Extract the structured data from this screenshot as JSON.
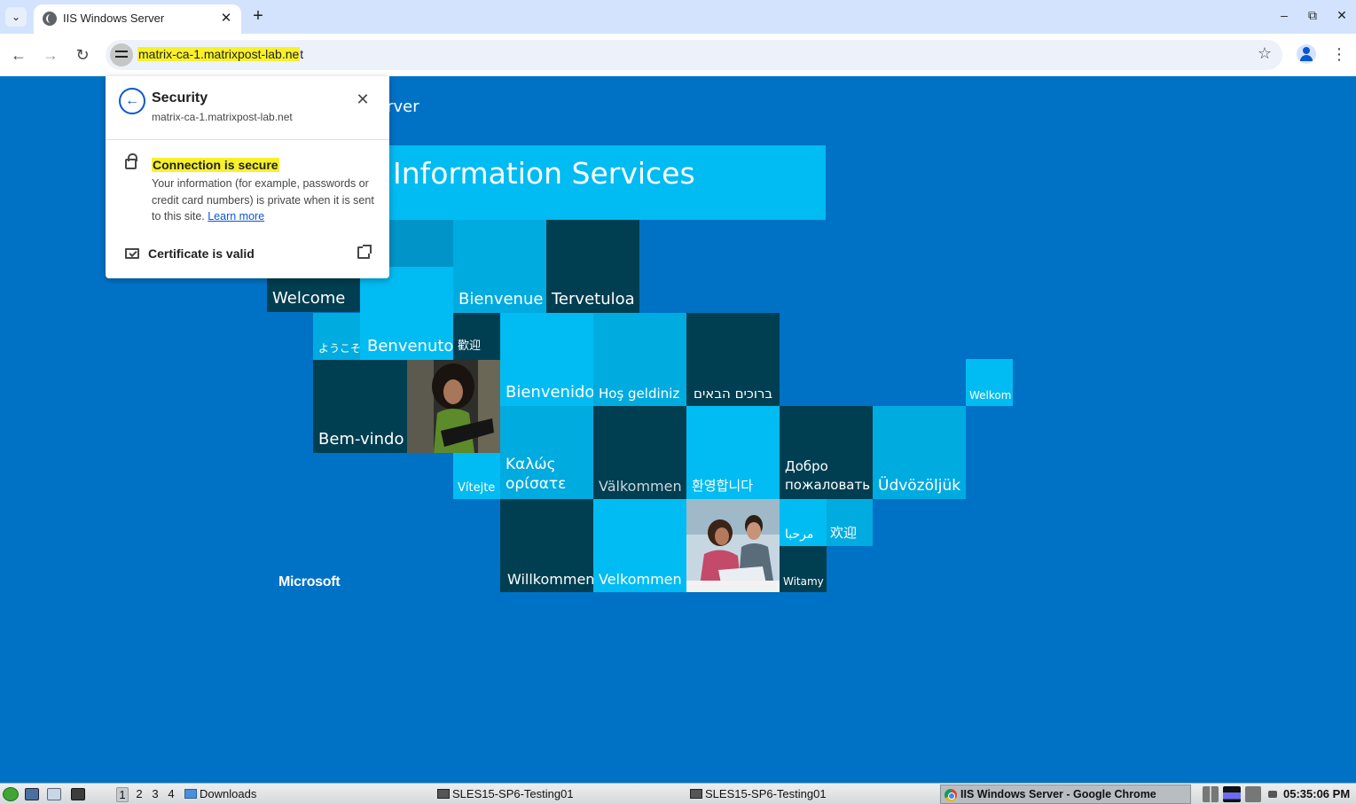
{
  "tab": {
    "title": "IIS Windows Server",
    "close": "✕"
  },
  "toolbar": {
    "back": "←",
    "forward": "→",
    "reload": "↻",
    "url_highlight": "matrix-ca-1.matrixpost-lab.ne",
    "url_rest": "t",
    "star": "☆",
    "menu": "⋮",
    "new_tab": "+",
    "tab_list": "⌄"
  },
  "window_controls": {
    "minimize": "–",
    "restore": "⧉",
    "close": "✕"
  },
  "popup": {
    "back": "←",
    "title": "Security",
    "host": "matrix-ca-1.matrixpost-lab.net",
    "close": "✕",
    "connection_title": "Connection is secure",
    "connection_desc": "Your information (for example, passwords or credit card numbers) is private when it is sent to this site.",
    "learn_more": "Learn more",
    "certificate": "Certificate is valid"
  },
  "page": {
    "header_fragment": "erver",
    "banner_fragment": "Information Services",
    "footer": "Microsoft",
    "tiles": {
      "welcome": "Welcome",
      "bienvenue": "Bienvenue",
      "tervetuloa": "Tervetuloa",
      "youkoso": "ようこそ",
      "benvenuto": "Benvenuto",
      "huanying_trad": "歡迎",
      "bienvenido": "Bienvenido",
      "hos_geldiniz": "Hoş geldiniz",
      "hebrew": "ברוכים הבאים",
      "welkom": "Welkom",
      "bem_vindo": "Bem-vindo",
      "vitejte": "Vítejte",
      "kalos_1": "Καλώς",
      "kalos_2": "ορίσατε",
      "valkommen": "Välkommen",
      "korean": "환영합니다",
      "dobro_1": "Добро",
      "dobro_2": "пожаловать",
      "udvozoljuk": "Üdvözöljük",
      "arabic": "مرحبا",
      "huanying_simp": "欢迎",
      "willkommen": "Willkommen",
      "velkommen": "Velkommen",
      "witamy": "Witamy"
    }
  },
  "taskbar": {
    "workspaces": [
      "1",
      "2",
      "3",
      "4"
    ],
    "downloads": "Downloads",
    "task1": "SLES15-SP6-Testing01",
    "task2": "SLES15-SP6-Testing01",
    "chrome_task": "IIS Windows Server - Google Chrome",
    "clock": "05:35:06 PM"
  }
}
